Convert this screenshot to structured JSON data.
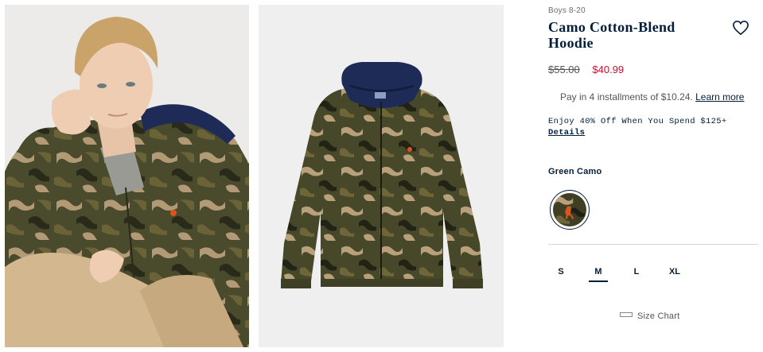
{
  "product": {
    "category": "Boys 8-20",
    "title": "Camo Cotton-Blend Hoodie",
    "price_original": "$55.00",
    "price_sale": "$40.99",
    "installment_text": "Pay in 4 installments of $10.24.",
    "installment_link": "Learn more",
    "promo_text": "Enjoy 40% Off When You Spend $125+",
    "promo_link": "Details",
    "color_name": "Green Camo",
    "sizes": [
      "S",
      "M",
      "L",
      "XL"
    ],
    "selected_size": "M",
    "size_chart_label": "Size Chart"
  },
  "icons": {
    "wishlist": "heart-icon",
    "size_chart": "ruler-icon"
  },
  "colors": {
    "brand_navy": "#041e3a",
    "sale_red": "#c8102e"
  }
}
